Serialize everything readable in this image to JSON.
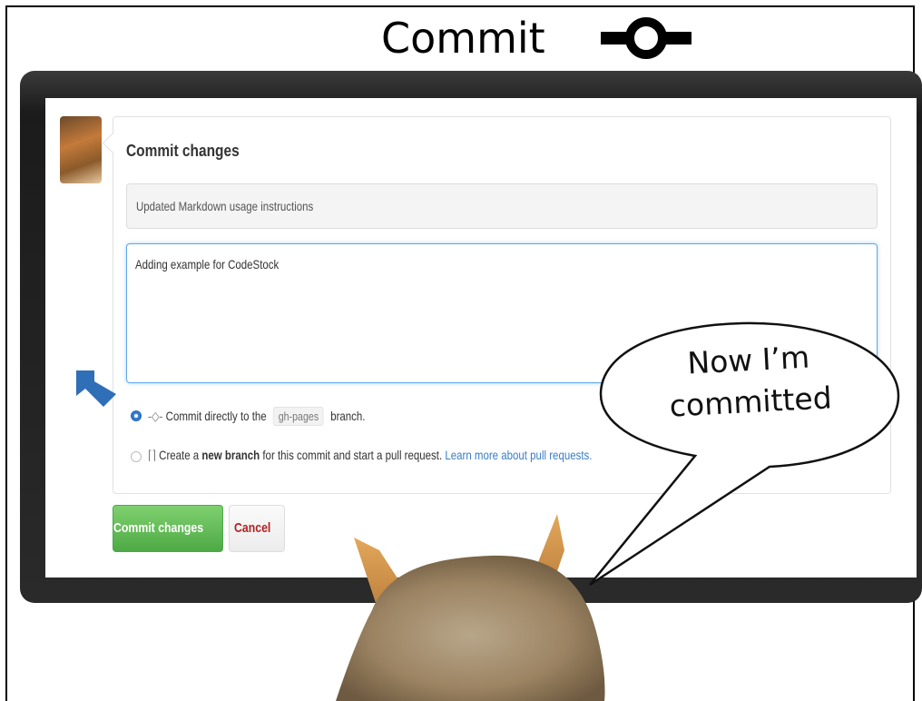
{
  "slide": {
    "title": "Commit",
    "commit_symbol_icon": "git-commit-icon"
  },
  "commit_form": {
    "heading": "Commit changes",
    "summary_value": "Updated Markdown usage instructions",
    "description_value": "Adding example for CodeStock",
    "option_direct": {
      "prefix": "Commit directly to the",
      "branch": "gh-pages",
      "suffix": "branch.",
      "selected": true
    },
    "option_new_branch": {
      "prefix": "Create a",
      "bold": "new branch",
      "middle": "for this commit and start a pull request.",
      "link": "Learn more about pull requests.",
      "selected": false
    },
    "commit_button_label": "Commit changes",
    "cancel_button_label": "Cancel"
  },
  "speech_bubble": {
    "line1": "Now I’m",
    "line2": "committed"
  },
  "colors": {
    "commit_button": "#4eaa45",
    "cancel_text": "#b02323",
    "link": "#3a7ec4",
    "focus_border": "#5fa8ea",
    "arrow": "#2f6fb7"
  }
}
